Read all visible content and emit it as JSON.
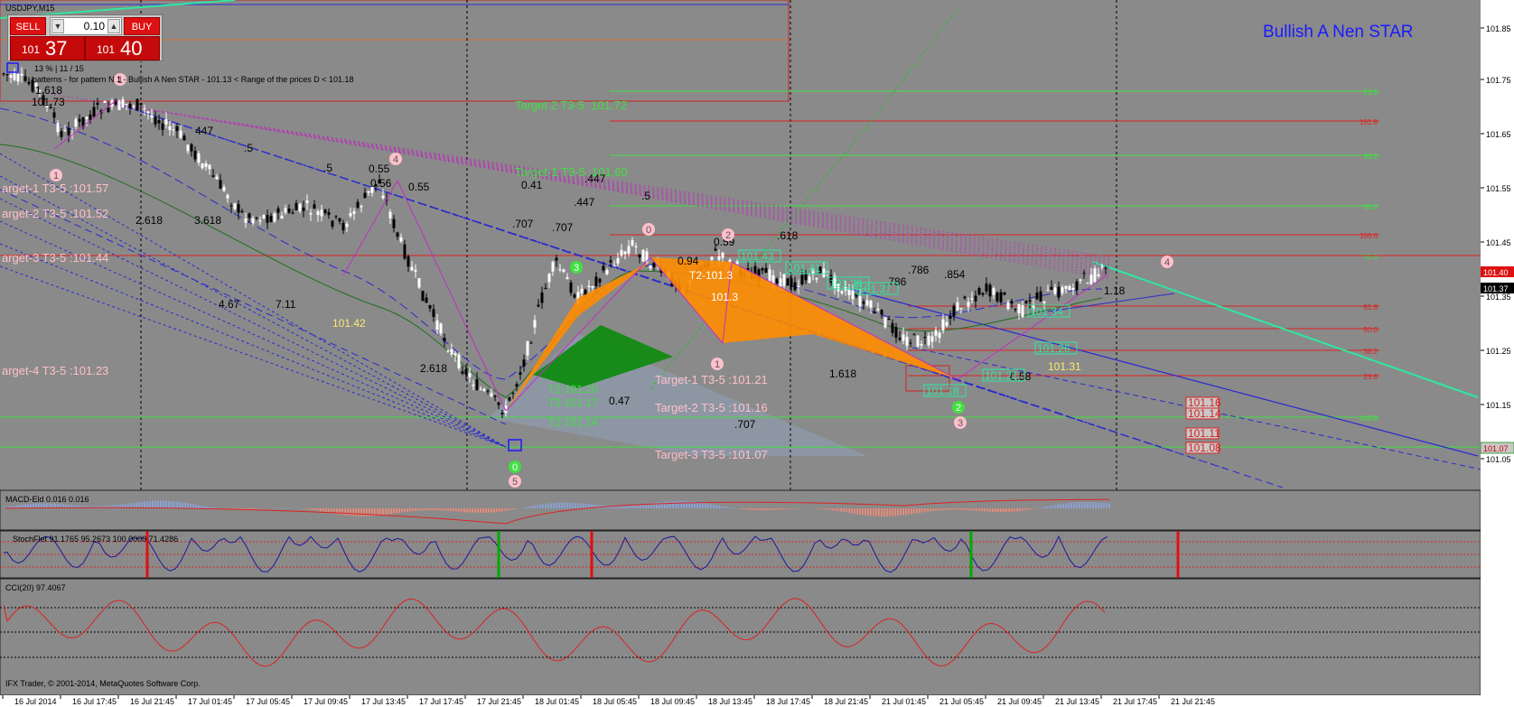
{
  "window": {
    "symbol_title": "USDJPY,M15",
    "strategy_title": "Bullish A Nen STAR",
    "pattern_info": "13 %  |  11 / 15",
    "pattern_desc": "patterns   - for pattern N 1 - Bullish A Nen STAR  - 101.13 < Range of the prices D < 101.18",
    "copyright": "IFX Trader, © 2001-2014, MetaQuotes Software Corp."
  },
  "trade_panel": {
    "sell_label": "SELL",
    "buy_label": "BUY",
    "lot_value": "0.10",
    "bid_prefix": "101",
    "bid_big": "37",
    "ask_prefix": "101",
    "ask_big": "40"
  },
  "price_axis": {
    "labels": [
      "101.85",
      "101.75",
      "101.65",
      "101.55",
      "101.45",
      "101.35",
      "101.25",
      "101.15",
      "101.05"
    ],
    "current_ask": "101.40",
    "current_bid": "101.37",
    "low_marker": "101.07"
  },
  "fib_right_labels": [
    "23.6",
    "161.8",
    "38.2",
    "50.0",
    "100.0",
    "61.8",
    "61.8",
    "50.0",
    "38.2",
    "23.6",
    "0.0",
    "100.0"
  ],
  "target_labels": [
    "Target 2 T3-5 :101.72",
    "Target-1 T3-5 :101.60",
    "arget-1 T3-5 :101.57",
    "arget-2 T3-5 :101.52",
    "arget-3 T3-5 :101.44",
    "arget-4 T3-5 :101.23",
    "Target-1 T3-5 :101.21",
    "Target-2 T3-5 :101.16",
    "Target-3 T3-5 :101.07"
  ],
  "fib_ratio_labels": [
    "-1.618",
    "101.73",
    "447",
    ".5",
    ".5",
    "0.55",
    "0.56",
    "0.55",
    "2.618",
    "3.618",
    "2.618",
    "4.67",
    "7.11",
    "0.41",
    ".447",
    ".447",
    ".5",
    ".707",
    ".707",
    "0.59",
    ".618",
    "0.94",
    ".786",
    ".786",
    ".854",
    "1.618",
    "0.47",
    ".707",
    "0.58",
    "1.18"
  ],
  "price_tags": [
    "101.42",
    "101.31",
    "T2-101.20",
    "T2-101.17",
    "T2-101.14",
    "101.43",
    "101.41",
    "101.39",
    "101.37",
    "101.18",
    "101.21",
    "101.26",
    "101.34",
    "T2-101.3",
    "101.3",
    "101.16",
    "101.14",
    "101.11",
    "101.08"
  ],
  "point_markers": [
    "1",
    "4",
    "0",
    "1",
    "2",
    "1",
    "3",
    "0",
    "5",
    "2",
    "4",
    "3"
  ],
  "indicators": {
    "macd": {
      "label": "MACD-Eld 0.016 0.016",
      "scale": [
        "0.036",
        "-0.069"
      ]
    },
    "stoch": {
      "label": "StochFlet 91.1765 95.2673 100.0000 71.4286",
      "scale": [
        "100",
        "80",
        "50",
        "20",
        "0"
      ]
    },
    "cci": {
      "label": "CCI(20) 97.4067",
      "scale": [
        "298.1965",
        "150",
        "0.00",
        "-150",
        "-344.0065"
      ]
    }
  },
  "time_axis": [
    "16 Jul 2014",
    "16 Jul 17:45",
    "16 Jul 21:45",
    "17 Jul 01:45",
    "17 Jul 05:45",
    "17 Jul 09:45",
    "17 Jul 13:45",
    "17 Jul 17:45",
    "17 Jul 21:45",
    "18 Jul 01:45",
    "18 Jul 05:45",
    "18 Jul 09:45",
    "18 Jul 13:45",
    "18 Jul 17:45",
    "18 Jul 21:45",
    "21 Jul 01:45",
    "21 Jul 05:45",
    "21 Jul 09:45",
    "21 Jul 13:45",
    "21 Jul 17:45",
    "21 Jul 21:45"
  ],
  "colors": {
    "background": "#8a8a8a",
    "axis_bg": "#ffffff",
    "bull_candle": "#ffffff",
    "bear_candle": "#000000",
    "pattern_orange": "#ff8c00",
    "pattern_green": "#0a8a0a",
    "trend_cyan": "#2de8a0",
    "fib_red": "#e02020",
    "fib_green": "#40e040",
    "title_blue": "#1a1aff"
  }
}
